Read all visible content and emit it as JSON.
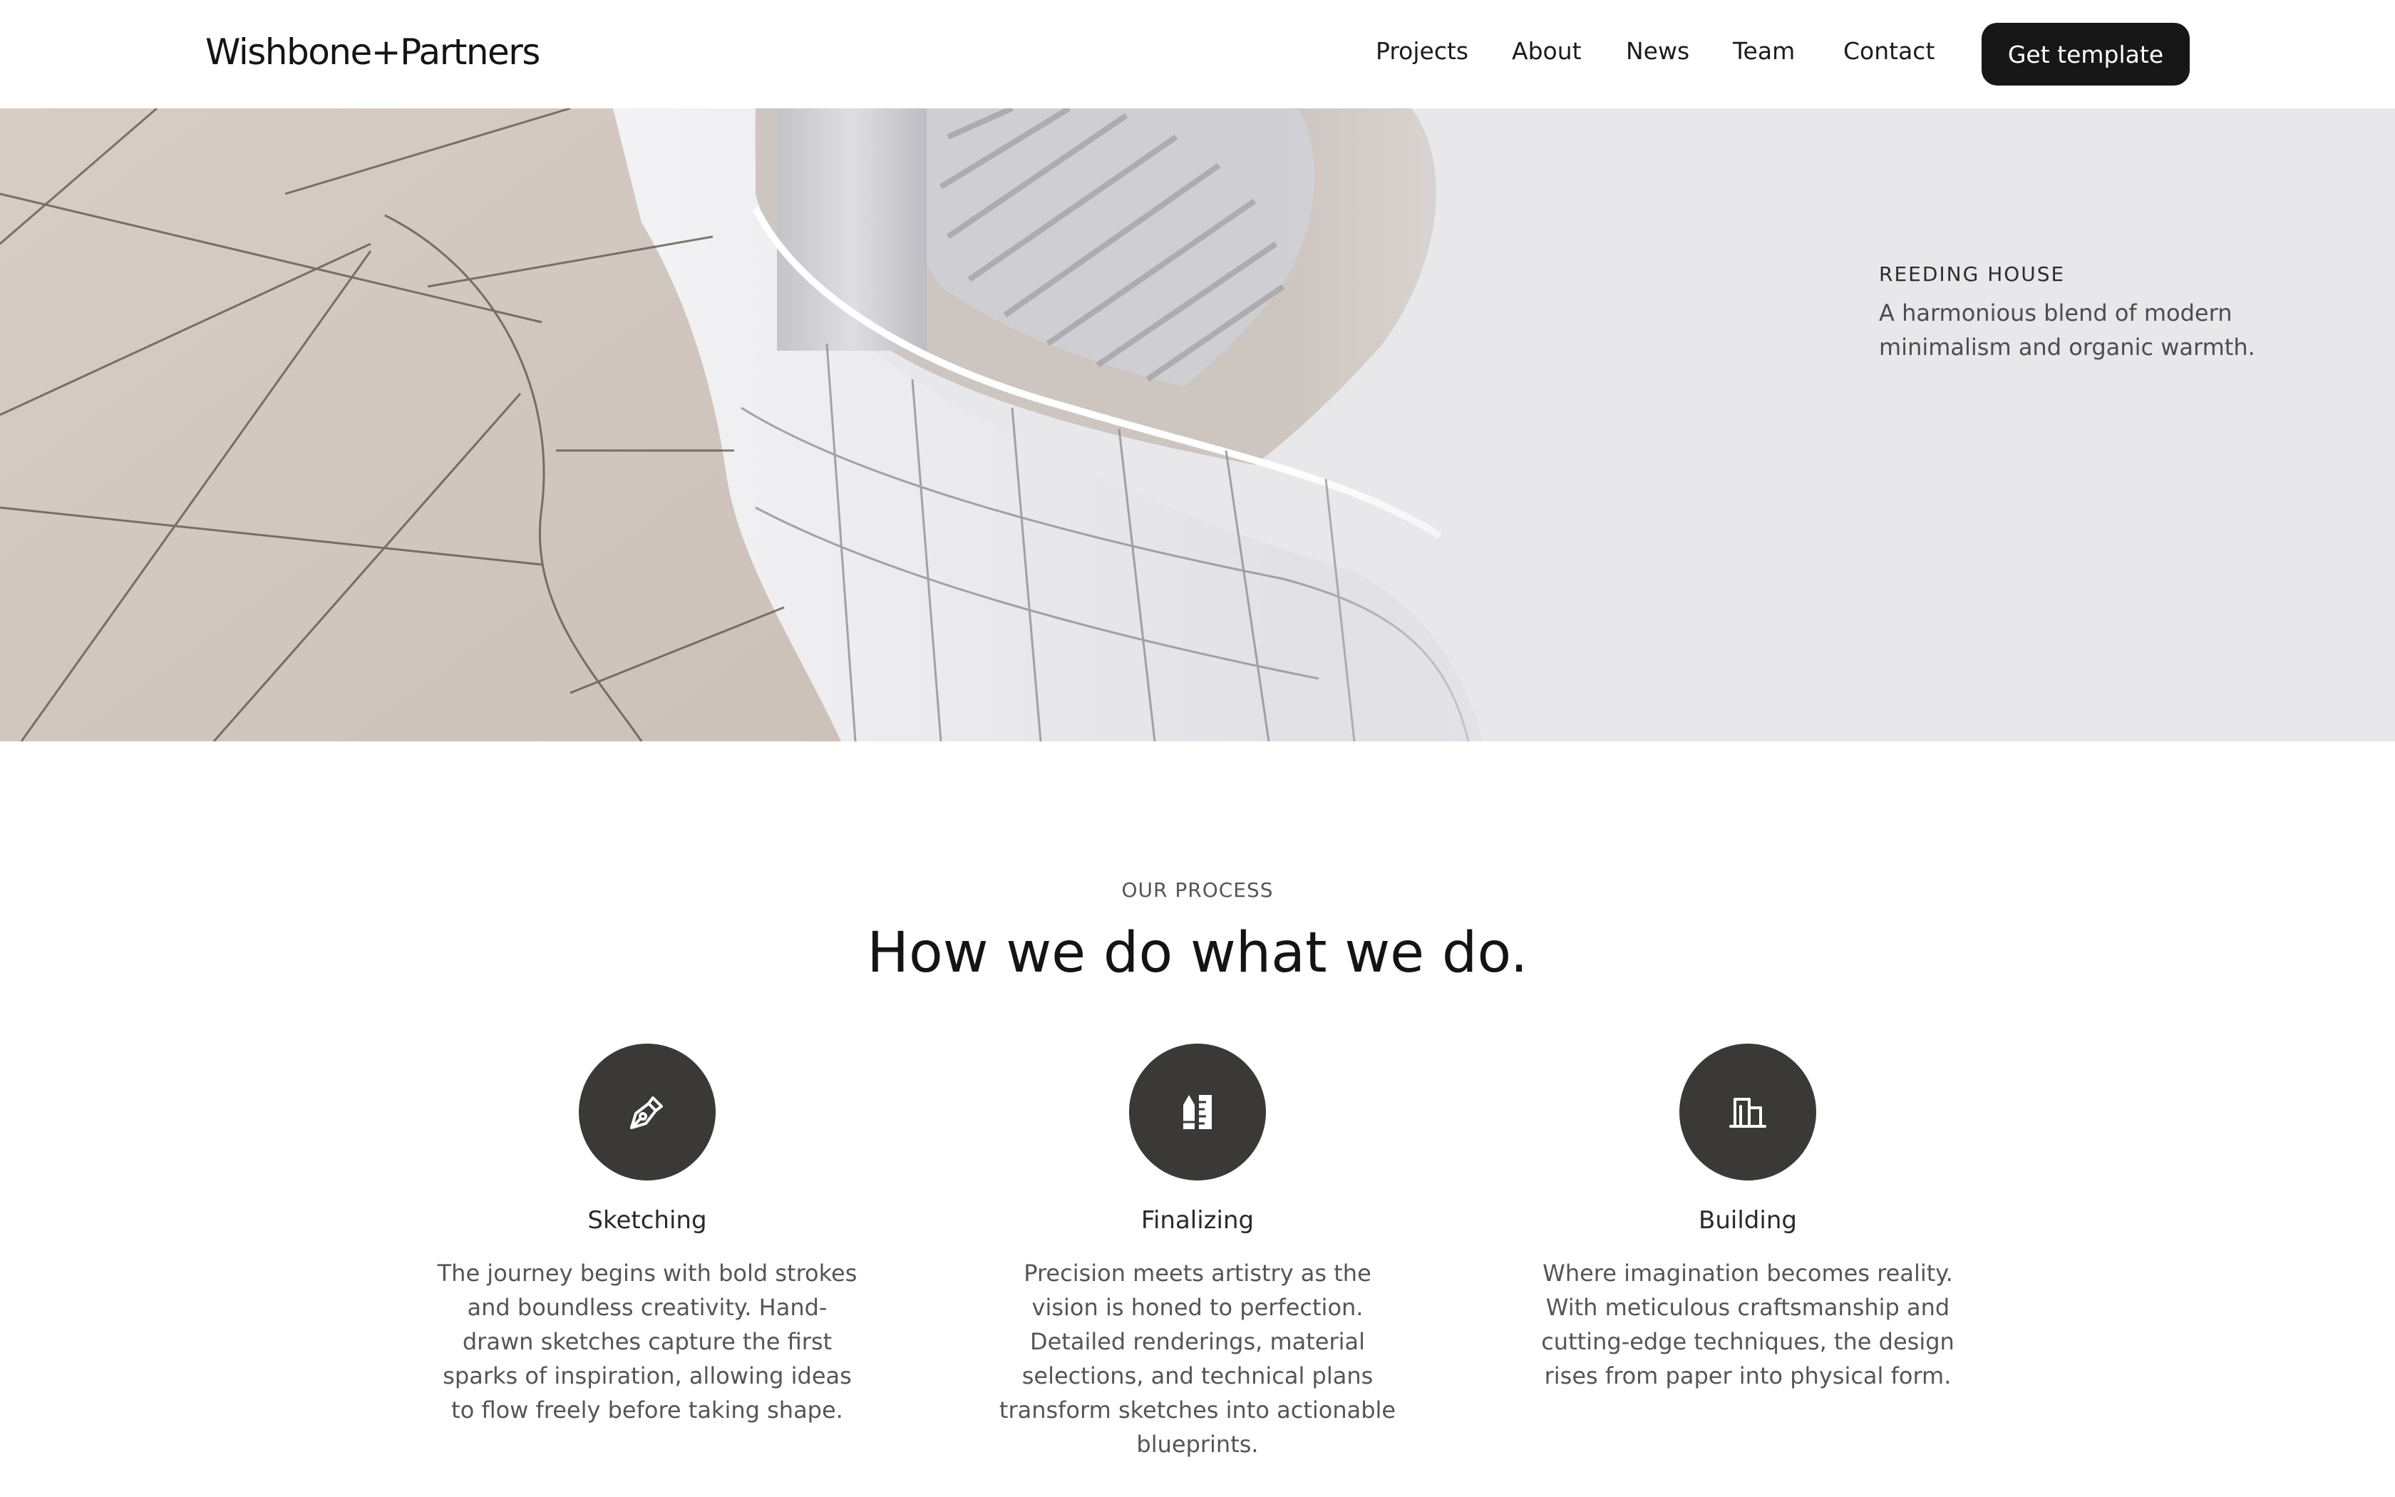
{
  "header": {
    "logo": "Wishbone+Partners",
    "nav": [
      "Projects",
      "About",
      "News",
      "Team",
      "Contact"
    ],
    "cta": "Get template"
  },
  "hero": {
    "kicker": "REEDING HOUSE",
    "description": "A harmonious blend of modern minimalism and organic warmth."
  },
  "process": {
    "kicker": "OUR PROCESS",
    "title": "How we do what we do.",
    "steps": [
      {
        "icon": "pen-nib-icon",
        "title": "Sketching",
        "description": "The journey begins with bold strokes and boundless creativity. Hand-drawn sketches capture the first sparks of inspiration, allowing ideas to flow freely before taking shape."
      },
      {
        "icon": "pencil-ruler-icon",
        "title": "Finalizing",
        "description": "Precision meets artistry as the vision is honed to perfection. Detailed renderings, material selections, and technical plans transform sketches into actionable blueprints."
      },
      {
        "icon": "building-icon",
        "title": "Building",
        "description": "Where imagination becomes reality. With meticulous craftsmanship and cutting-edge techniques, the design rises from paper into physical form."
      }
    ]
  },
  "colors": {
    "cta_background": "#171717",
    "icon_circle": "#3a3938",
    "hero_background": "#e8e7ea"
  }
}
